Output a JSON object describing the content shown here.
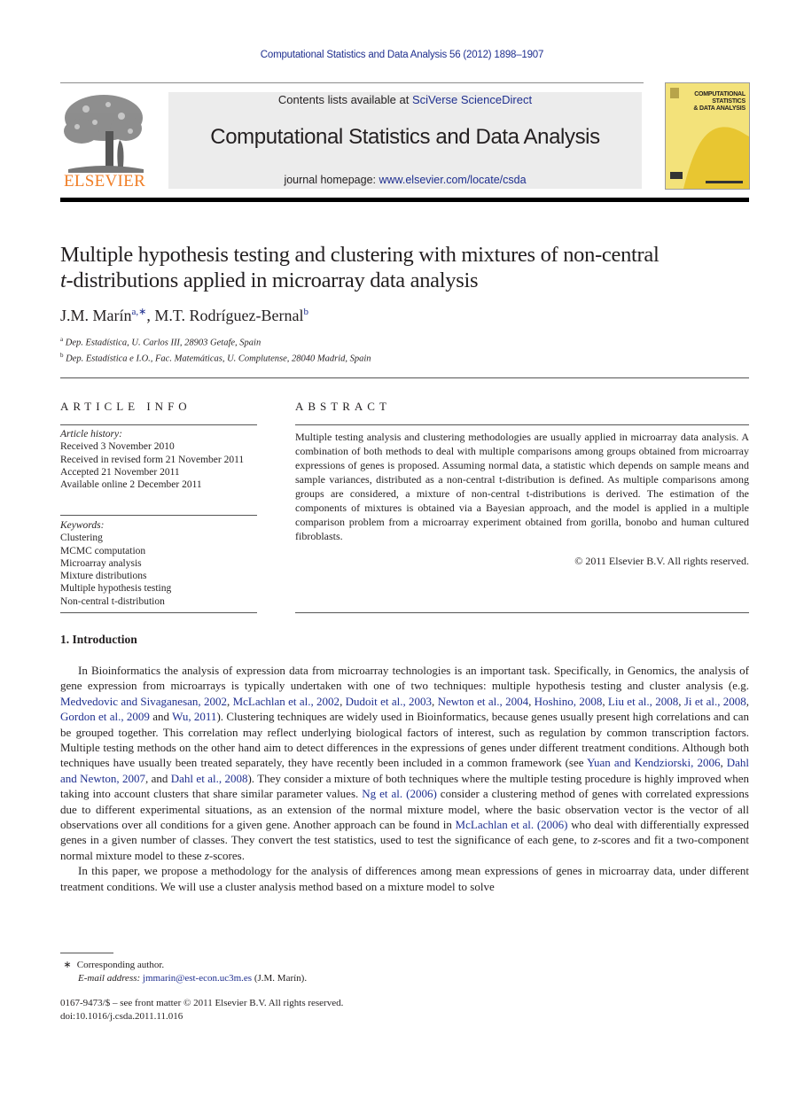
{
  "running_head": "Computational Statistics and Data Analysis 56 (2012) 1898–1907",
  "masthead": {
    "publisher_logo_text": "ELSEVIER",
    "contents_prefix": "Contents lists available at ",
    "contents_link": "SciVerse ScienceDirect",
    "journal_title": "Computational Statistics and Data Analysis",
    "homepage_prefix": "journal homepage: ",
    "homepage_link": "www.elsevier.com/locate/csda",
    "cover_title_lines": [
      "COMPUTATIONAL",
      "STATISTICS",
      "& DATA ANALYSIS"
    ]
  },
  "article": {
    "title_line1": "Multiple hypothesis testing and clustering with mixtures of non-central",
    "title_line2_italic": "t",
    "title_line2_rest": "-distributions applied in microarray data analysis",
    "authors": [
      {
        "name": "J.M. Marín",
        "marks": "a,∗"
      },
      {
        "name": "M.T. Rodríguez-Bernal",
        "marks": "b"
      }
    ],
    "affiliations": [
      {
        "mark": "a",
        "text": "Dep. Estadística, U. Carlos III, 28903 Getafe, Spain"
      },
      {
        "mark": "b",
        "text": "Dep. Estadística e I.O., Fac. Matemáticas, U. Complutense, 28040 Madrid, Spain"
      }
    ]
  },
  "article_info": {
    "heading": "ARTICLE INFO",
    "history_label": "Article history:",
    "history": [
      "Received 3 November 2010",
      "Received in revised form 21 November 2011",
      "Accepted 21 November 2011",
      "Available online 2 December 2011"
    ],
    "keywords_label": "Keywords:",
    "keywords": [
      "Clustering",
      "MCMC computation",
      "Microarray analysis",
      "Mixture distributions",
      "Multiple hypothesis testing",
      "Non-central t-distribution"
    ]
  },
  "abstract": {
    "heading": "ABSTRACT",
    "text": "Multiple testing analysis and clustering methodologies are usually applied in microarray data analysis. A combination of both methods to deal with multiple comparisons among groups obtained from microarray expressions of genes is proposed. Assuming normal data, a statistic which depends on sample means and sample variances, distributed as a non-central t-distribution is defined. As multiple comparisons among groups are considered, a mixture of non-central t-distributions is derived. The estimation of the components of mixtures is obtained via a Bayesian approach, and the model is applied in a multiple comparison problem from a microarray experiment obtained from gorilla, bonobo and human cultured fibroblasts.",
    "copyright": "© 2011 Elsevier B.V. All rights reserved."
  },
  "introduction": {
    "heading": "1.  Introduction",
    "p1": [
      {
        "t": "In Bioinformatics the analysis of expression data from microarray technologies is an important task. Specifically, in Genomics, the analysis of gene expression from microarrays is typically undertaken with one of two techniques: multiple hypothesis testing and cluster analysis (e.g. "
      },
      {
        "t": "Medvedovic and Sivaganesan, 2002",
        "link": true
      },
      {
        "t": ", "
      },
      {
        "t": "McLachlan et al., 2002",
        "link": true
      },
      {
        "t": ", "
      },
      {
        "t": "Dudoit et al., 2003",
        "link": true
      },
      {
        "t": ", "
      },
      {
        "t": "Newton et al., 2004",
        "link": true
      },
      {
        "t": ", "
      },
      {
        "t": "Hoshino, 2008",
        "link": true
      },
      {
        "t": ", "
      },
      {
        "t": "Liu et al., 2008",
        "link": true
      },
      {
        "t": ", "
      },
      {
        "t": "Ji et al., 2008",
        "link": true
      },
      {
        "t": ", "
      },
      {
        "t": "Gordon et al., 2009",
        "link": true
      },
      {
        "t": " and "
      },
      {
        "t": "Wu, 2011",
        "link": true
      },
      {
        "t": "). Clustering techniques are widely used in Bioinformatics, because genes usually present high correlations and can be grouped together. This correlation may reflect underlying biological factors of interest, such as regulation by common transcription factors. Multiple testing methods on the other hand aim to detect differences in the expressions of genes under different treatment conditions. Although both techniques have usually been treated separately, they have recently been included in a common framework (see "
      },
      {
        "t": "Yuan and Kendziorski, 2006",
        "link": true
      },
      {
        "t": ", "
      },
      {
        "t": "Dahl and Newton, 2007",
        "link": true
      },
      {
        "t": ", and "
      },
      {
        "t": "Dahl et al., 2008",
        "link": true
      },
      {
        "t": "). They consider a mixture of both techniques where the multiple testing procedure is highly improved when taking into account clusters that share similar parameter values. "
      },
      {
        "t": "Ng et al. (2006)",
        "link": true
      },
      {
        "t": " consider a clustering method of genes with correlated expressions due to different experimental situations, as an extension of the normal mixture model, where the basic observation vector is the vector of all observations over all conditions for a given gene. Another approach can be found in "
      },
      {
        "t": "McLachlan et al. (2006)",
        "link": true
      },
      {
        "t": " who deal with differentially expressed genes in a given number of classes. They convert the test statistics, used to test the significance of each gene, to "
      },
      {
        "t": "z",
        "italic": true
      },
      {
        "t": "-scores and fit a two-component normal mixture model to these "
      },
      {
        "t": "z",
        "italic": true
      },
      {
        "t": "-scores."
      }
    ],
    "p2": "In this paper, we propose a methodology for the analysis of differences among mean expressions of genes in microarray data, under different treatment conditions. We will use a cluster analysis method based on a mixture model to solve"
  },
  "footnotes": {
    "star": "∗",
    "corresponding": "Corresponding author.",
    "email_label": "E-mail address: ",
    "email": "jmmarin@est-econ.uc3m.es",
    "email_suffix": " (J.M. Marín).",
    "front_matter": "0167-9473/$ – see front matter © 2011 Elsevier B.V. All rights reserved.",
    "doi": "doi:10.1016/j.csda.2011.11.016"
  }
}
